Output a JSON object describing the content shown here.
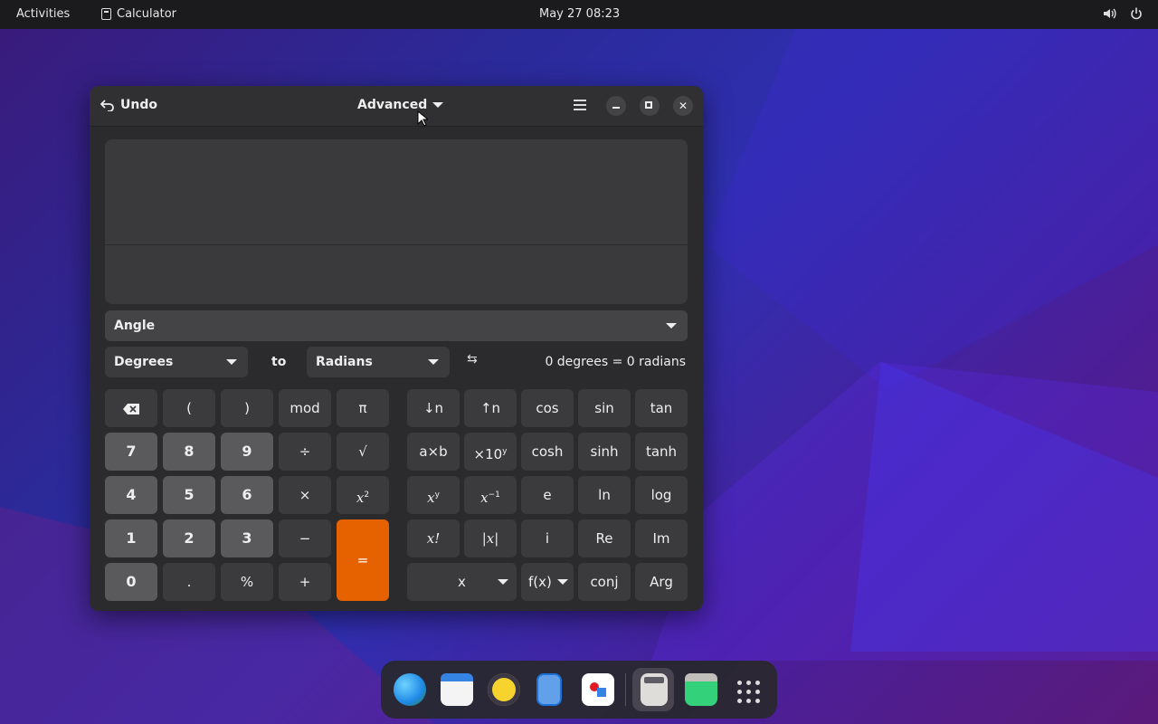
{
  "topbar": {
    "activities": "Activities",
    "app_name": "Calculator",
    "clock": "May 27  08:23",
    "icons": [
      "volume-icon",
      "power-icon"
    ]
  },
  "window": {
    "undo_label": "Undo",
    "mode_label": "Advanced",
    "menu_icon": "hamburger-menu-icon"
  },
  "conversion": {
    "category": "Angle",
    "from_unit": "Degrees",
    "to_word": "to",
    "to_unit": "Radians",
    "swap_symbol": "⇆",
    "result": "0 degrees  =  0 radians"
  },
  "keypad": {
    "backspace": "⌫",
    "open_paren": "(",
    "close_paren": ")",
    "mod": "mod",
    "pi": "π",
    "n7": "7",
    "n8": "8",
    "n9": "9",
    "divide": "÷",
    "sqrt": "√",
    "n4": "4",
    "n5": "5",
    "n6": "6",
    "multiply": "×",
    "square_base": "x",
    "square_exp": "2",
    "n1": "1",
    "n2": "2",
    "n3": "3",
    "subtract": "−",
    "equals": "=",
    "n0": "0",
    "point": ".",
    "percent": "%",
    "add": "+"
  },
  "advanced": {
    "subscript": "↓n",
    "superscript": "↑n",
    "cos": "cos",
    "sin": "sin",
    "tan": "tan",
    "factorize": "a×b",
    "exp10_base": "×10",
    "exp10_exp": "y",
    "cosh": "cosh",
    "sinh": "sinh",
    "tanh": "tanh",
    "power_base": "x",
    "power_exp": "y",
    "inverse_base": "x",
    "inverse_exp": "−1",
    "e": "e",
    "ln": "ln",
    "log": "log",
    "factorial": "x!",
    "abs": "|x|",
    "i": "i",
    "re": "Re",
    "im": "Im",
    "variable": "x",
    "function": "f(x)",
    "conj": "conj",
    "arg": "Arg"
  },
  "dock": {
    "items": [
      "browser-icon",
      "calendar-icon",
      "music-icon",
      "text-editor-icon",
      "software-store-icon",
      "calculator-icon",
      "recycle-icon",
      "app-grid-icon"
    ]
  }
}
